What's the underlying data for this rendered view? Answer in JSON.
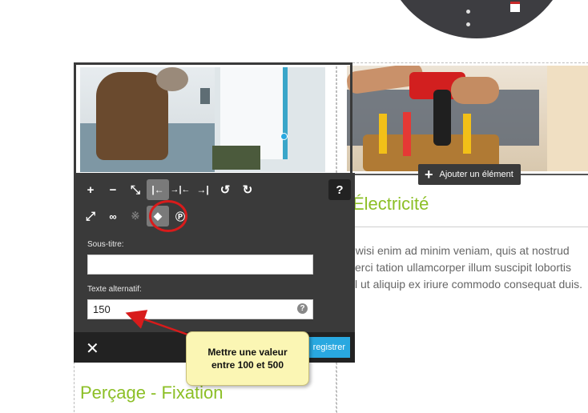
{
  "right_card": {
    "add_element_label": "Ajouter un élément",
    "title": "Électricité",
    "body": "t wisi enim ad minim veniam, quis at nostrud\nxerci tation ullamcorper illum suscipit lobortis\nsl ut aliquip ex iriure commodo consequat duis."
  },
  "editor": {
    "toolbar_row1": [
      {
        "name": "zoom-in-icon",
        "glyph": "+"
      },
      {
        "name": "zoom-out-icon",
        "glyph": "−"
      },
      {
        "name": "fullscreen-icon",
        "glyph": "⤡"
      },
      {
        "name": "align-left-icon",
        "glyph": "|←",
        "active": true
      },
      {
        "name": "align-center-icon",
        "glyph": "→|←"
      },
      {
        "name": "align-right-icon",
        "glyph": "→|"
      },
      {
        "name": "undo-icon",
        "glyph": "↺"
      },
      {
        "name": "redo-icon",
        "glyph": "↻"
      }
    ],
    "toolbar_row2": [
      {
        "name": "resize-icon",
        "glyph": "⤢"
      },
      {
        "name": "link-icon",
        "glyph": "🔗"
      },
      {
        "name": "unlink-icon",
        "glyph": "⛓",
        "dim": true
      },
      {
        "name": "tag-icon",
        "glyph": "🏷",
        "active": true
      },
      {
        "name": "pinterest-icon",
        "glyph": "P"
      }
    ],
    "help_glyph": "?",
    "subtitle_label": "Sous-titre:",
    "subtitle_value": "",
    "alt_label": "Texte alternatif:",
    "alt_value": "150",
    "alt_help": "?",
    "close_glyph": "✕",
    "save_label": "registrer"
  },
  "left_card": {
    "title": "Perçage - Fixation"
  },
  "callout": {
    "line1": "Mettre une valeur",
    "line2": "entre 100 et 500"
  },
  "colors": {
    "accent_green": "#8cbf26",
    "save_blue": "#29a8e0",
    "annotation_red": "#d81b1b"
  }
}
